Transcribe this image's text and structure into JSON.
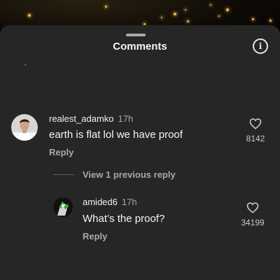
{
  "sheet": {
    "title": "Comments",
    "icons": {
      "info": "info-icon",
      "handle": "drag-handle"
    }
  },
  "comments": [
    {
      "username": "realest_adamko",
      "time": "17h",
      "text": "earth is flat lol we have proof",
      "reply_label": "Reply",
      "likes": "8142",
      "avatar_icon": "avatar"
    }
  ],
  "view_previous": "View 1 previous reply",
  "replies": [
    {
      "username": "amided6",
      "time": "17h",
      "text": "What’s the proof?",
      "reply_label": "Reply",
      "likes": "34199",
      "avatar_icon": "avatar"
    }
  ],
  "colors": {
    "sheet_bg": "#262626",
    "text_primary": "#f5f5f5",
    "text_secondary": "#a8a8a8"
  }
}
